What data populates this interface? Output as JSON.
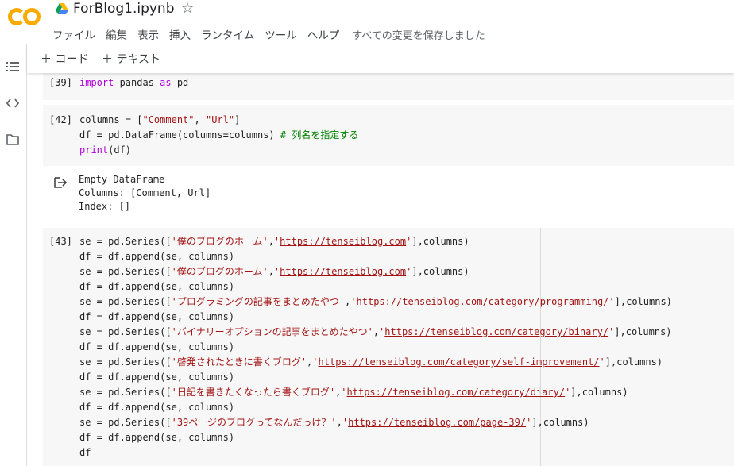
{
  "header": {
    "logo_text": "CO",
    "notebook_title": "ForBlog1.ipynb",
    "star_glyph": "☆",
    "menu": [
      "ファイル",
      "編集",
      "表示",
      "挿入",
      "ランタイム",
      "ツール",
      "ヘルプ"
    ],
    "save_status": "すべての変更を保存しました"
  },
  "toolbar": {
    "add_code": "＋ コード",
    "add_text": "＋ テキスト"
  },
  "rail_icons": [
    "toc-icon",
    "code-snippets-icon",
    "files-icon"
  ],
  "cells": [
    {
      "exec_count": "[39]",
      "lines": [
        [
          {
            "t": "import",
            "c": "kw"
          },
          {
            "t": " pandas ",
            "c": ""
          },
          {
            "t": "as",
            "c": "kw"
          },
          {
            "t": " pd",
            "c": ""
          }
        ]
      ]
    },
    {
      "exec_count": "[42]",
      "lines": [
        [
          {
            "t": "columns = [",
            "c": ""
          },
          {
            "t": "\"Comment\"",
            "c": "str"
          },
          {
            "t": ", ",
            "c": ""
          },
          {
            "t": "\"Url\"",
            "c": "str"
          },
          {
            "t": "]",
            "c": ""
          }
        ],
        [
          {
            "t": "df = pd.DataFrame(columns=columns) ",
            "c": ""
          },
          {
            "t": "# 列名を指定する",
            "c": "comment"
          }
        ],
        [
          {
            "t": "print",
            "c": "kw"
          },
          {
            "t": "(df)",
            "c": ""
          }
        ]
      ],
      "output": [
        "Empty DataFrame",
        "Columns: [Comment, Url]",
        "Index: []"
      ]
    },
    {
      "exec_count": "[43]",
      "lines": [
        [
          {
            "t": "se = pd.Series([",
            "c": ""
          },
          {
            "t": "'僕のブログのホーム'",
            "c": "str"
          },
          {
            "t": ",",
            "c": ""
          },
          {
            "t": "'",
            "c": "str"
          },
          {
            "t": "https://tenseiblog.com",
            "c": "url"
          },
          {
            "t": "'",
            "c": "str"
          },
          {
            "t": "],columns)",
            "c": ""
          }
        ],
        [
          {
            "t": "df = df.append(se, columns)",
            "c": ""
          }
        ],
        [
          {
            "t": "se = pd.Series([",
            "c": ""
          },
          {
            "t": "'僕のブログのホーム'",
            "c": "str"
          },
          {
            "t": ",",
            "c": ""
          },
          {
            "t": "'",
            "c": "str"
          },
          {
            "t": "https://tenseiblog.com",
            "c": "url"
          },
          {
            "t": "'",
            "c": "str"
          },
          {
            "t": "],columns)",
            "c": ""
          }
        ],
        [
          {
            "t": "df = df.append(se, columns)",
            "c": ""
          }
        ],
        [
          {
            "t": "se = pd.Series([",
            "c": ""
          },
          {
            "t": "'プログラミングの記事をまとめたやつ'",
            "c": "str"
          },
          {
            "t": ",",
            "c": ""
          },
          {
            "t": "'",
            "c": "str"
          },
          {
            "t": "https://tenseiblog.com/category/programming/",
            "c": "url"
          },
          {
            "t": "'",
            "c": "str"
          },
          {
            "t": "],columns)",
            "c": ""
          }
        ],
        [
          {
            "t": "df = df.append(se, columns)",
            "c": ""
          }
        ],
        [
          {
            "t": "se = pd.Series([",
            "c": ""
          },
          {
            "t": "'バイナリーオプションの記事をまとめたやつ'",
            "c": "str"
          },
          {
            "t": ",",
            "c": ""
          },
          {
            "t": "'",
            "c": "str"
          },
          {
            "t": "https://tenseiblog.com/category/binary/",
            "c": "url"
          },
          {
            "t": "'",
            "c": "str"
          },
          {
            "t": "],columns)",
            "c": ""
          }
        ],
        [
          {
            "t": "df = df.append(se, columns)",
            "c": ""
          }
        ],
        [
          {
            "t": "se = pd.Series([",
            "c": ""
          },
          {
            "t": "'啓発されたときに書くブログ'",
            "c": "str"
          },
          {
            "t": ",",
            "c": ""
          },
          {
            "t": "'",
            "c": "str"
          },
          {
            "t": "https://tenseiblog.com/category/self-improvement/",
            "c": "url"
          },
          {
            "t": "'",
            "c": "str"
          },
          {
            "t": "],columns)",
            "c": ""
          }
        ],
        [
          {
            "t": "df = df.append(se, columns)",
            "c": ""
          }
        ],
        [
          {
            "t": "se = pd.Series([",
            "c": ""
          },
          {
            "t": "'日記を書きたくなったら書くブログ'",
            "c": "str"
          },
          {
            "t": ",",
            "c": ""
          },
          {
            "t": "'",
            "c": "str"
          },
          {
            "t": "https://tenseiblog.com/category/diary/",
            "c": "url"
          },
          {
            "t": "'",
            "c": "str"
          },
          {
            "t": "],columns)",
            "c": ""
          }
        ],
        [
          {
            "t": "df = df.append(se, columns)",
            "c": ""
          }
        ],
        [
          {
            "t": "se = pd.Series([",
            "c": ""
          },
          {
            "t": "'39ページのブログってなんだっけ？'",
            "c": "str"
          },
          {
            "t": ",",
            "c": ""
          },
          {
            "t": "'",
            "c": "str"
          },
          {
            "t": "https://tenseiblog.com/page-39/",
            "c": "url"
          },
          {
            "t": "'",
            "c": "str"
          },
          {
            "t": "],columns)",
            "c": ""
          }
        ],
        [
          {
            "t": "df = df.append(se, columns)",
            "c": ""
          }
        ],
        [
          {
            "t": "df",
            "c": ""
          }
        ]
      ]
    }
  ]
}
